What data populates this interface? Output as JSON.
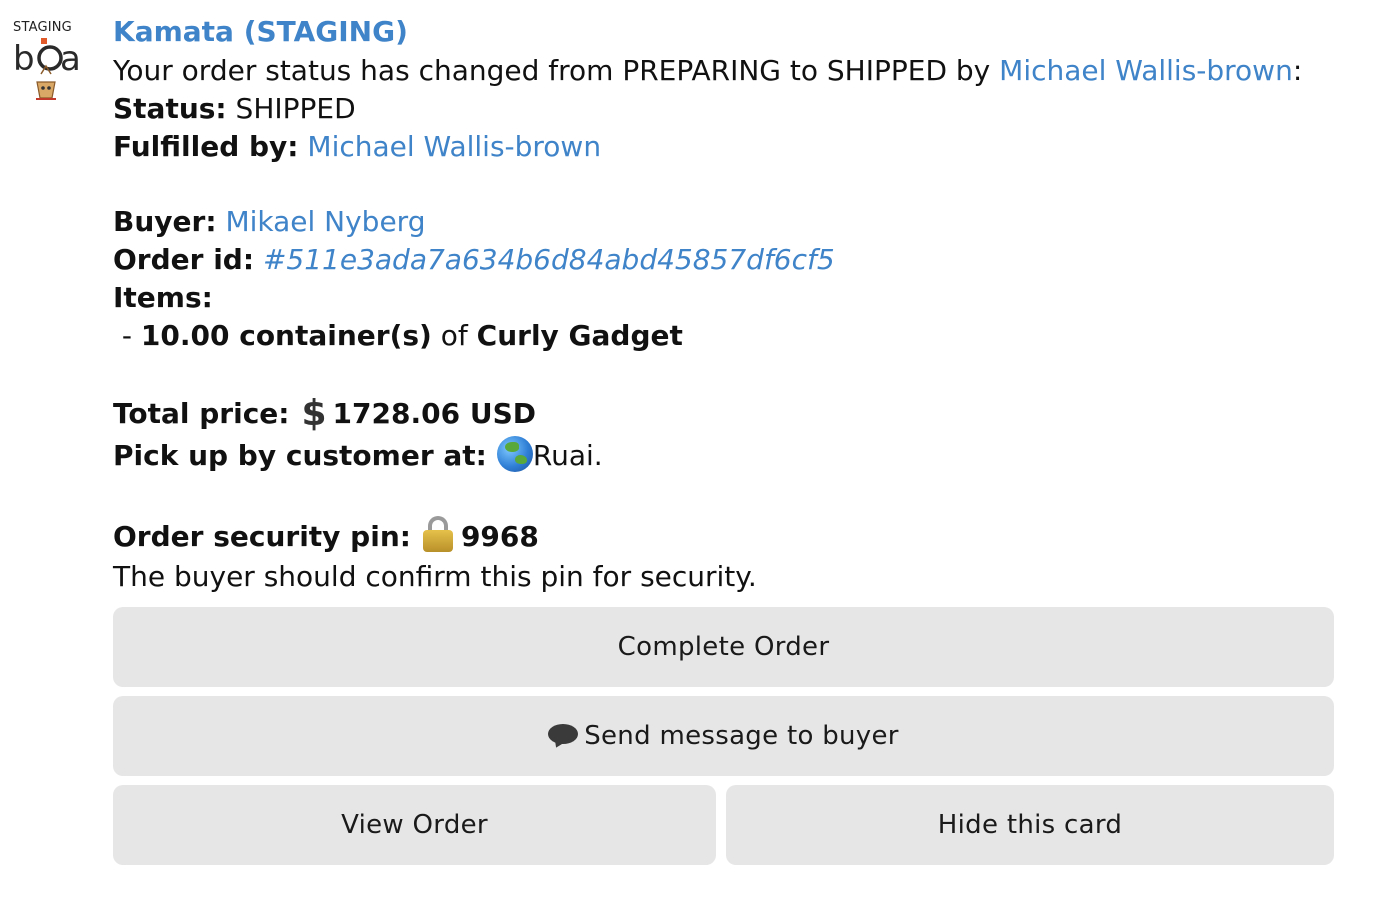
{
  "avatar": {
    "badge_text": "STAGING",
    "logo_text": "bja",
    "icon": "bot-logo-icon"
  },
  "message": {
    "sender": "Kamata (STAGING)",
    "intro_prefix": "Your order status has changed from PREPARING to SHIPPED by ",
    "intro_user": "Michael Wallis-brown",
    "intro_suffix": ":",
    "status_label": "Status:",
    "status_value": " SHIPPED",
    "fulfilled_label": "Fulfilled by:",
    "fulfilled_value": "Michael Wallis-brown",
    "buyer_label": "Buyer:",
    "buyer_value": "Mikael Nyberg",
    "order_id_label": "Order id:",
    "order_id_value": "#511e3ada7a634b6d84abd45857df6cf5",
    "items_label": "Items:",
    "item_prefix": " - ",
    "item_quantity": "10.00 container(s)",
    "item_of": " of ",
    "item_name": "Curly Gadget",
    "total_label": "Total price:",
    "currency_symbol": "$",
    "total_value": "1728.06 USD",
    "pickup_label": "Pick up by customer at:",
    "pickup_value": "Ruai.",
    "pin_label": "Order security pin:",
    "pin_value": "9968",
    "pin_note": "The buyer should confirm this pin for security."
  },
  "buttons": {
    "complete": "Complete Order",
    "message": "Send message to buyer",
    "view": "View Order",
    "hide": "Hide this card"
  },
  "colors": {
    "link": "#3f83c8",
    "button_bg": "#e6e6e6"
  }
}
